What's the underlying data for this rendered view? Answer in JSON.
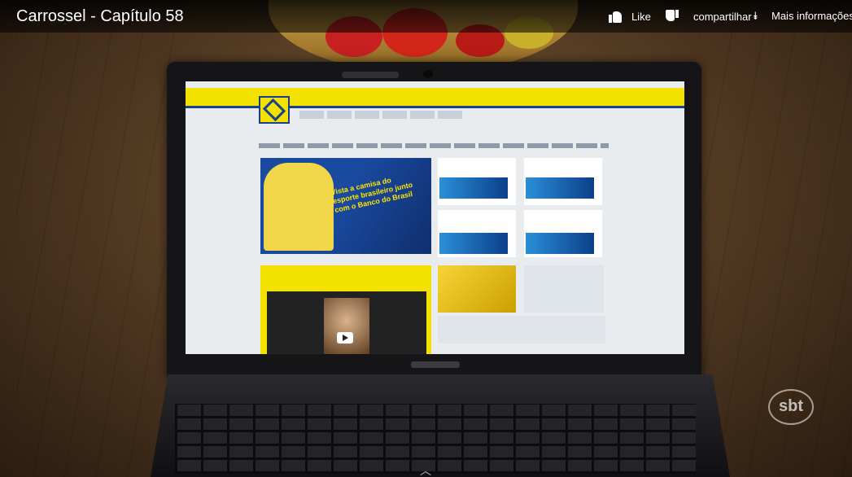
{
  "video": {
    "title": "Carrossel - Capítulo 58",
    "like_label": "Like",
    "share_label": "compartilhar",
    "more_info_label": "Mais informações",
    "watermark_text": "sbt"
  },
  "laptop_site": {
    "banner_text": "Vista a camisa do esporte brasileiro junto com o Banco do Brasil",
    "brand_color": "#f3e200",
    "accent_color": "#1b3f8f"
  },
  "icons": {
    "like": "thumbs-up-icon",
    "dislike": "thumbs-down-icon",
    "share": "share-arrow-icon",
    "expand": "chevron-up-icon"
  }
}
